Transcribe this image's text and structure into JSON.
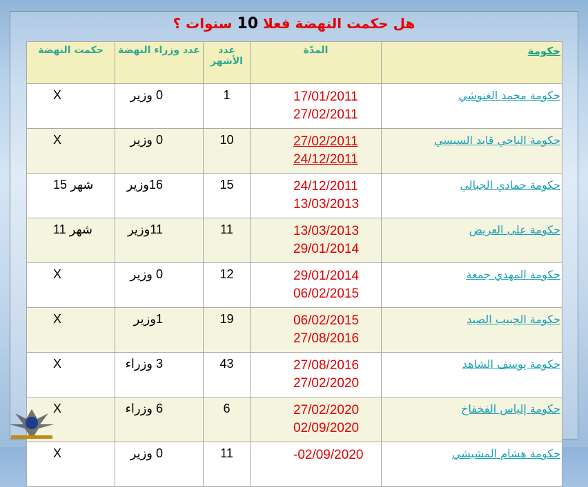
{
  "title": {
    "prefix": "هل حكمت النهضة فعلا ",
    "number": "10",
    "suffix": " سنوات ؟"
  },
  "headers": {
    "government": "حكومة",
    "period": "المدّة",
    "months": "عدد الأشهر",
    "ministers": "عدد وزراء النهضة",
    "ruled": "حكمت النهضة"
  },
  "rows": [
    {
      "government": "حكومة محمد الغنوشي",
      "start": "17/01/2011",
      "end": "27/02/2011",
      "months": "1",
      "ministers": "0 وزير",
      "ruled": "X"
    },
    {
      "government": "حكومة الباجي قايد السبسي",
      "start": "27/02/2011",
      "end": "24/12/2011",
      "months": "10",
      "ministers": "0 وزير",
      "ruled": "X"
    },
    {
      "government": "حكومة حمادي الجبالي",
      "start": "24/12/2011",
      "end": "13/03/2013",
      "months": "15",
      "ministers": "16وزير",
      "ruled": "15 شهر"
    },
    {
      "government": "حكومة على العريض",
      "start": "13/03/2013",
      "end": "29/01/2014",
      "months": "11",
      "ministers": "11وزير",
      "ruled": "11 شهر"
    },
    {
      "government": "حكومة المهدي جمعة",
      "start": "29/01/2014",
      "end": "06/02/2015",
      "months": "12",
      "ministers": "0 وزير",
      "ruled": "X"
    },
    {
      "government": "حكومة الحبيب الصيد",
      "start": "06/02/2015",
      "end": "27/08/2016",
      "months": "19",
      "ministers": "1وزير",
      "ruled": "X"
    },
    {
      "government": "حكومة يوسف الشاهد",
      "start": "27/08/2016",
      "end": "27/02/2020",
      "months": "43",
      "ministers": "3 وزراء",
      "ruled": "X"
    },
    {
      "government": "حكومة إلياس الفخفاخ",
      "start": "27/02/2020",
      "end": "02/09/2020",
      "months": "6",
      "ministers": "6 وزراء",
      "ruled": "X"
    },
    {
      "government": "حكومة هشام المشيشي",
      "start": "02/09/2020-",
      "end": "",
      "months": "11",
      "ministers": "0 وزير",
      "ruled": "X"
    }
  ]
}
